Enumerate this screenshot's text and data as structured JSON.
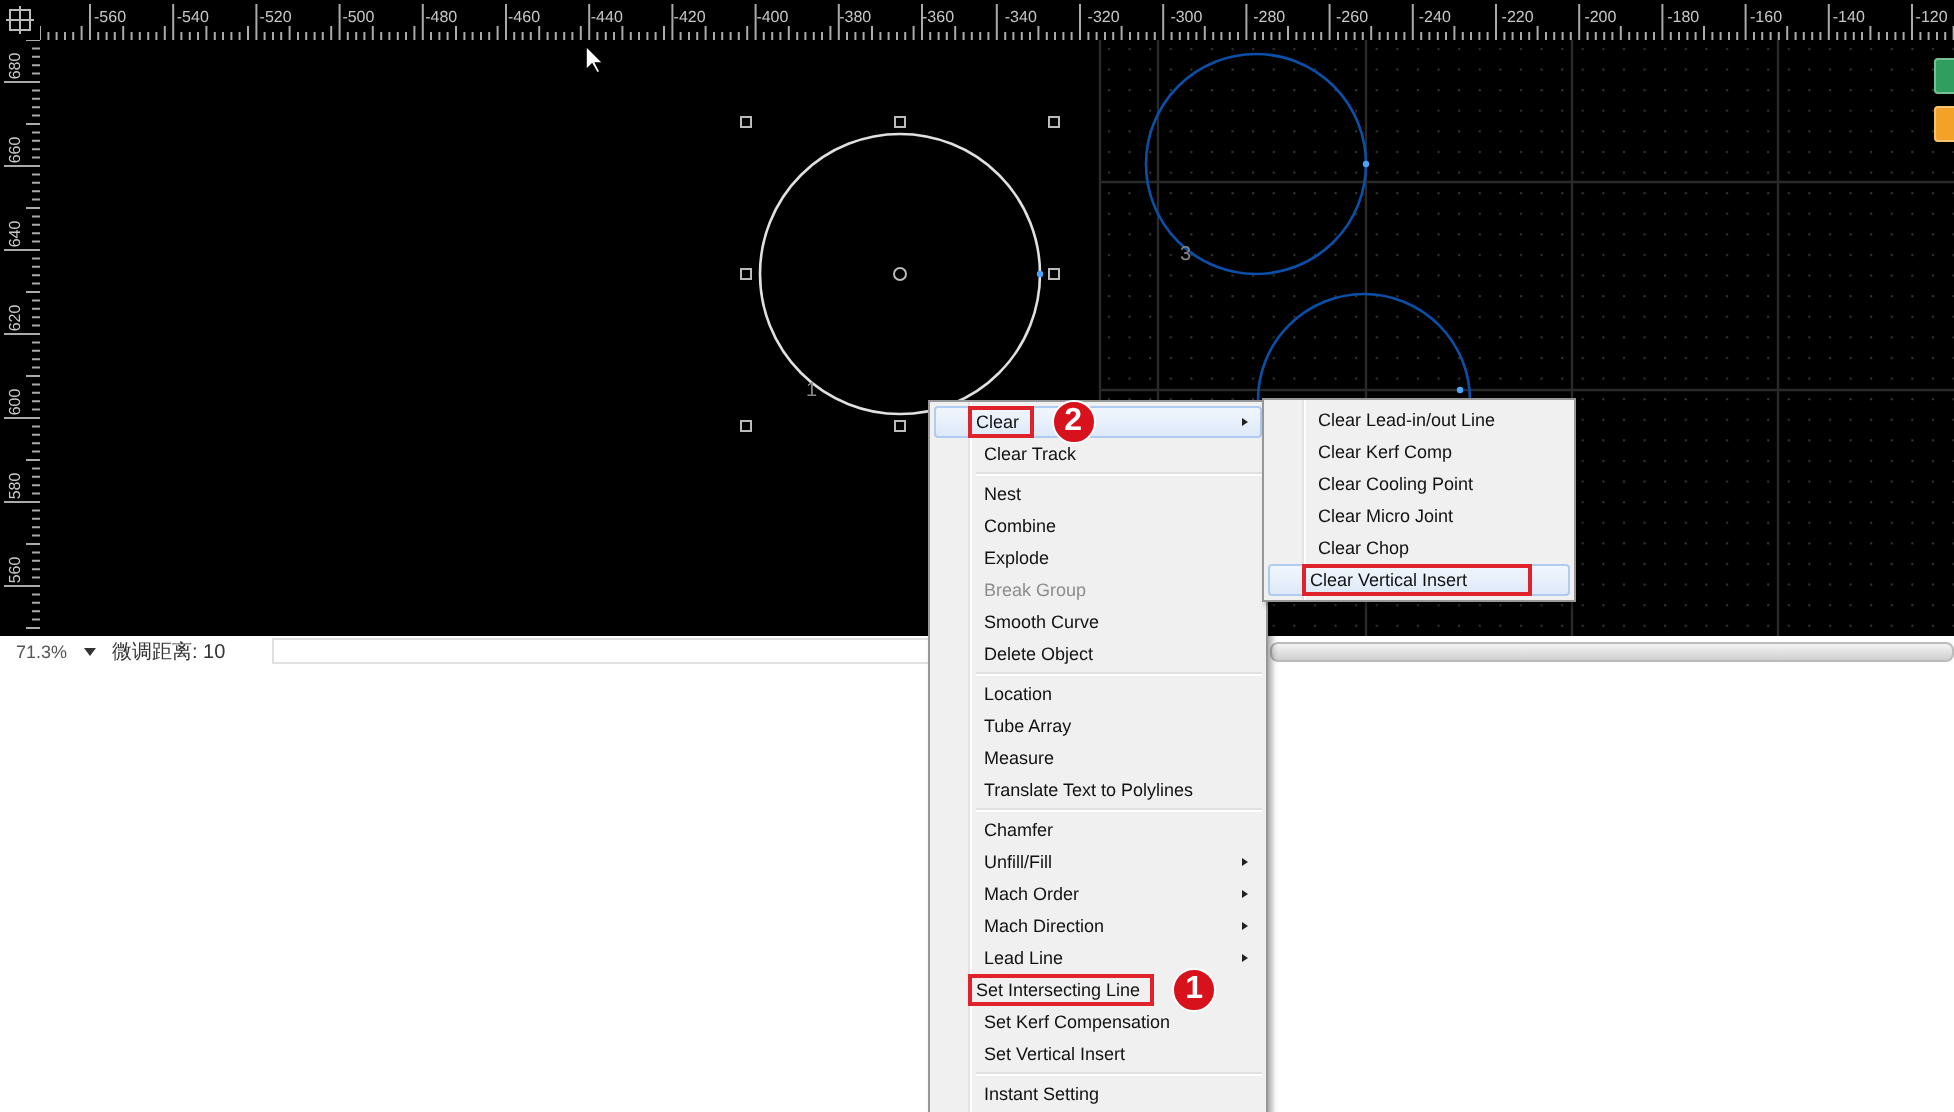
{
  "top_ruler": {
    "labels": [
      "-560",
      "-540",
      "-520",
      "-500",
      "-480",
      "-460",
      "-440",
      "-420",
      "-400",
      "-380",
      "-360",
      "-340",
      "-320",
      "-300",
      "-280",
      "-260",
      "-240",
      "-220",
      "-200",
      "-180",
      "-160",
      "-140",
      "-120"
    ]
  },
  "left_ruler": {
    "labels": [
      "680",
      "660",
      "640",
      "620",
      "600",
      "580",
      "560"
    ]
  },
  "canvas": {
    "shapes": [
      {
        "kind": "circle",
        "color": "#e0e0e0",
        "selected": true,
        "label": "1"
      },
      {
        "kind": "circle",
        "color": "#0a4fa8",
        "selected": false,
        "label": "3"
      },
      {
        "kind": "circle",
        "color": "#0a4fa8",
        "selected": false
      }
    ]
  },
  "side_buttons": [
    {
      "color": "#2f9e5e"
    },
    {
      "color": "#f2a227"
    }
  ],
  "status_bar": {
    "zoom": "71.3%",
    "nudge": "微调距离: 10"
  },
  "context_menu": {
    "items": [
      {
        "kind": "item",
        "label": "Clear",
        "disabled": false,
        "submenu": true,
        "highlighted": true,
        "boxed": true,
        "callout": "2"
      },
      {
        "kind": "item",
        "label": "Clear Track",
        "disabled": false,
        "submenu": false,
        "highlighted": false,
        "boxed": false
      },
      {
        "kind": "separator"
      },
      {
        "kind": "item",
        "label": "Nest",
        "disabled": false,
        "submenu": false,
        "highlighted": false,
        "boxed": false
      },
      {
        "kind": "item",
        "label": "Combine",
        "disabled": false,
        "submenu": false,
        "highlighted": false,
        "boxed": false
      },
      {
        "kind": "item",
        "label": "Explode",
        "disabled": false,
        "submenu": false,
        "highlighted": false,
        "boxed": false
      },
      {
        "kind": "item",
        "label": "Break Group",
        "disabled": true,
        "submenu": false,
        "highlighted": false,
        "boxed": false
      },
      {
        "kind": "item",
        "label": "Smooth Curve",
        "disabled": false,
        "submenu": false,
        "highlighted": false,
        "boxed": false
      },
      {
        "kind": "item",
        "label": "Delete Object",
        "disabled": false,
        "submenu": false,
        "highlighted": false,
        "boxed": false
      },
      {
        "kind": "separator"
      },
      {
        "kind": "item",
        "label": "Location",
        "disabled": false,
        "submenu": false,
        "highlighted": false,
        "boxed": false
      },
      {
        "kind": "item",
        "label": "Tube Array",
        "disabled": false,
        "submenu": false,
        "highlighted": false,
        "boxed": false
      },
      {
        "kind": "item",
        "label": "Measure",
        "disabled": false,
        "submenu": false,
        "highlighted": false,
        "boxed": false
      },
      {
        "kind": "item",
        "label": "Translate Text to Polylines",
        "disabled": false,
        "submenu": false,
        "highlighted": false,
        "boxed": false
      },
      {
        "kind": "separator"
      },
      {
        "kind": "item",
        "label": "Chamfer",
        "disabled": false,
        "submenu": false,
        "highlighted": false,
        "boxed": false
      },
      {
        "kind": "item",
        "label": "Unfill/Fill",
        "disabled": false,
        "submenu": true,
        "highlighted": false,
        "boxed": false
      },
      {
        "kind": "item",
        "label": "Mach Order",
        "disabled": false,
        "submenu": true,
        "highlighted": false,
        "boxed": false
      },
      {
        "kind": "item",
        "label": "Mach Direction",
        "disabled": false,
        "submenu": true,
        "highlighted": false,
        "boxed": false
      },
      {
        "kind": "item",
        "label": "Lead Line",
        "disabled": false,
        "submenu": true,
        "highlighted": false,
        "boxed": false
      },
      {
        "kind": "item",
        "label": "Set Intersecting Line",
        "disabled": false,
        "submenu": false,
        "highlighted": false,
        "boxed": true,
        "callout": "1"
      },
      {
        "kind": "item",
        "label": "Set Kerf Compensation",
        "disabled": false,
        "submenu": false,
        "highlighted": false,
        "boxed": false
      },
      {
        "kind": "item",
        "label": "Set Vertical Insert",
        "disabled": false,
        "submenu": false,
        "highlighted": false,
        "boxed": false
      },
      {
        "kind": "separator"
      },
      {
        "kind": "item",
        "label": "Instant Setting",
        "disabled": false,
        "submenu": false,
        "highlighted": false,
        "boxed": false
      }
    ]
  },
  "submenu": {
    "items": [
      {
        "label": "Clear Lead-in/out Line",
        "highlighted": false,
        "boxed": false
      },
      {
        "label": "Clear Kerf Comp",
        "highlighted": false,
        "boxed": false
      },
      {
        "label": "Clear Cooling Point",
        "highlighted": false,
        "boxed": false
      },
      {
        "label": "Clear Micro Joint",
        "highlighted": false,
        "boxed": false
      },
      {
        "label": "Clear Chop",
        "highlighted": false,
        "boxed": false
      },
      {
        "label": "Clear Vertical Insert",
        "highlighted": true,
        "boxed": true
      }
    ]
  }
}
